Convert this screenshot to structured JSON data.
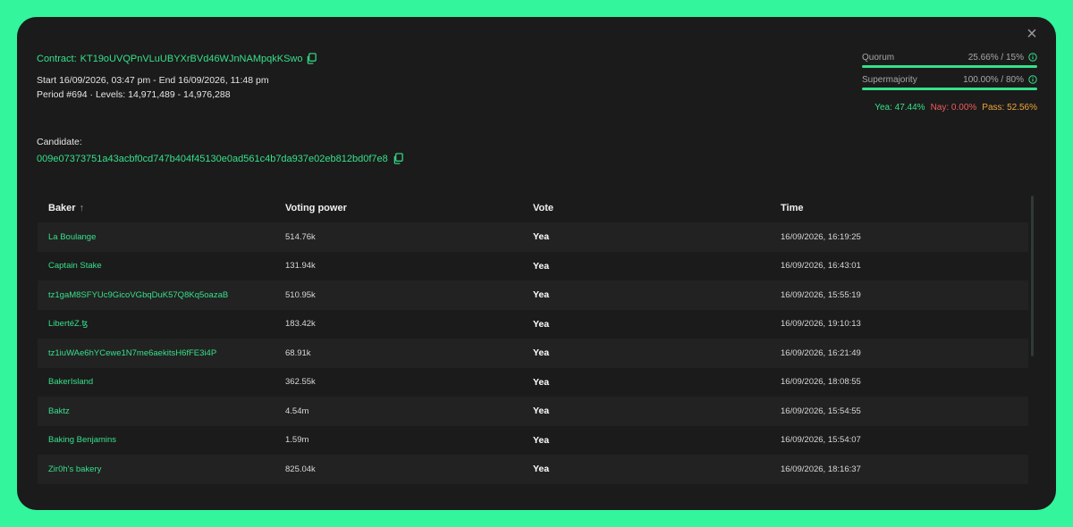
{
  "contract": {
    "label": "Contract:",
    "address": "KT19oUVQPnVLuUBYXrBVd46WJnNAMpqkKSwo"
  },
  "period": {
    "dates": "Start 16/09/2026, 03:47 pm - End 16/09/2026, 11:48 pm",
    "levels": "Period #694 · Levels: 14,971,489 - 14,976,288"
  },
  "candidate": {
    "label": "Candidate:",
    "hash": "009e07373751a43acbf0cd747b404f45130e0ad561c4b7da937e02eb812bd0f7e8"
  },
  "stats": {
    "quorum": {
      "label": "Quorum",
      "value": "25.66% / 15%",
      "fill": 1.0
    },
    "supermajority": {
      "label": "Supermajority",
      "value": "100.00% / 80%",
      "fill": 1.0
    },
    "yea": "Yea: 47.44%",
    "nay": "Nay: 0.00%",
    "pass": "Pass: 52.56%"
  },
  "table": {
    "headers": {
      "baker": "Baker",
      "power": "Voting power",
      "vote": "Vote",
      "time": "Time"
    },
    "sort_indicator": "↑",
    "rows": [
      {
        "baker": "La Boulange",
        "power": "514.76k",
        "vote": "Yea",
        "time": "16/09/2026, 16:19:25"
      },
      {
        "baker": "Captain Stake",
        "power": "131.94k",
        "vote": "Yea",
        "time": "16/09/2026, 16:43:01"
      },
      {
        "baker": "tz1gaM8SFYUc9GicoVGbqDuK57Q8Kq5oazaB",
        "power": "510.95k",
        "vote": "Yea",
        "time": "16/09/2026, 15:55:19"
      },
      {
        "baker": "LibertéZ.ꜩ",
        "power": "183.42k",
        "vote": "Yea",
        "time": "16/09/2026, 19:10:13"
      },
      {
        "baker": "tz1iuWAe6hYCewe1N7me6aekitsH6fFE3i4P",
        "power": "68.91k",
        "vote": "Yea",
        "time": "16/09/2026, 16:21:49"
      },
      {
        "baker": "BakerIsland",
        "power": "362.55k",
        "vote": "Yea",
        "time": "16/09/2026, 18:08:55"
      },
      {
        "baker": "Baktz",
        "power": "4.54m",
        "vote": "Yea",
        "time": "16/09/2026, 15:54:55"
      },
      {
        "baker": "Baking Benjamins",
        "power": "1.59m",
        "vote": "Yea",
        "time": "16/09/2026, 15:54:07"
      },
      {
        "baker": "Zir0h's bakery",
        "power": "825.04k",
        "vote": "Yea",
        "time": "16/09/2026, 18:16:37"
      }
    ]
  },
  "icons": {
    "close": "close-icon",
    "copy": "copy-icon",
    "info": "info-icon",
    "sort": "sort-arrow-icon"
  },
  "colors": {
    "accent": "#36e08a",
    "nay": "#f25b5b",
    "pass": "#f0a43a",
    "background": "#33f59c",
    "panel": "#1b1b1b"
  }
}
